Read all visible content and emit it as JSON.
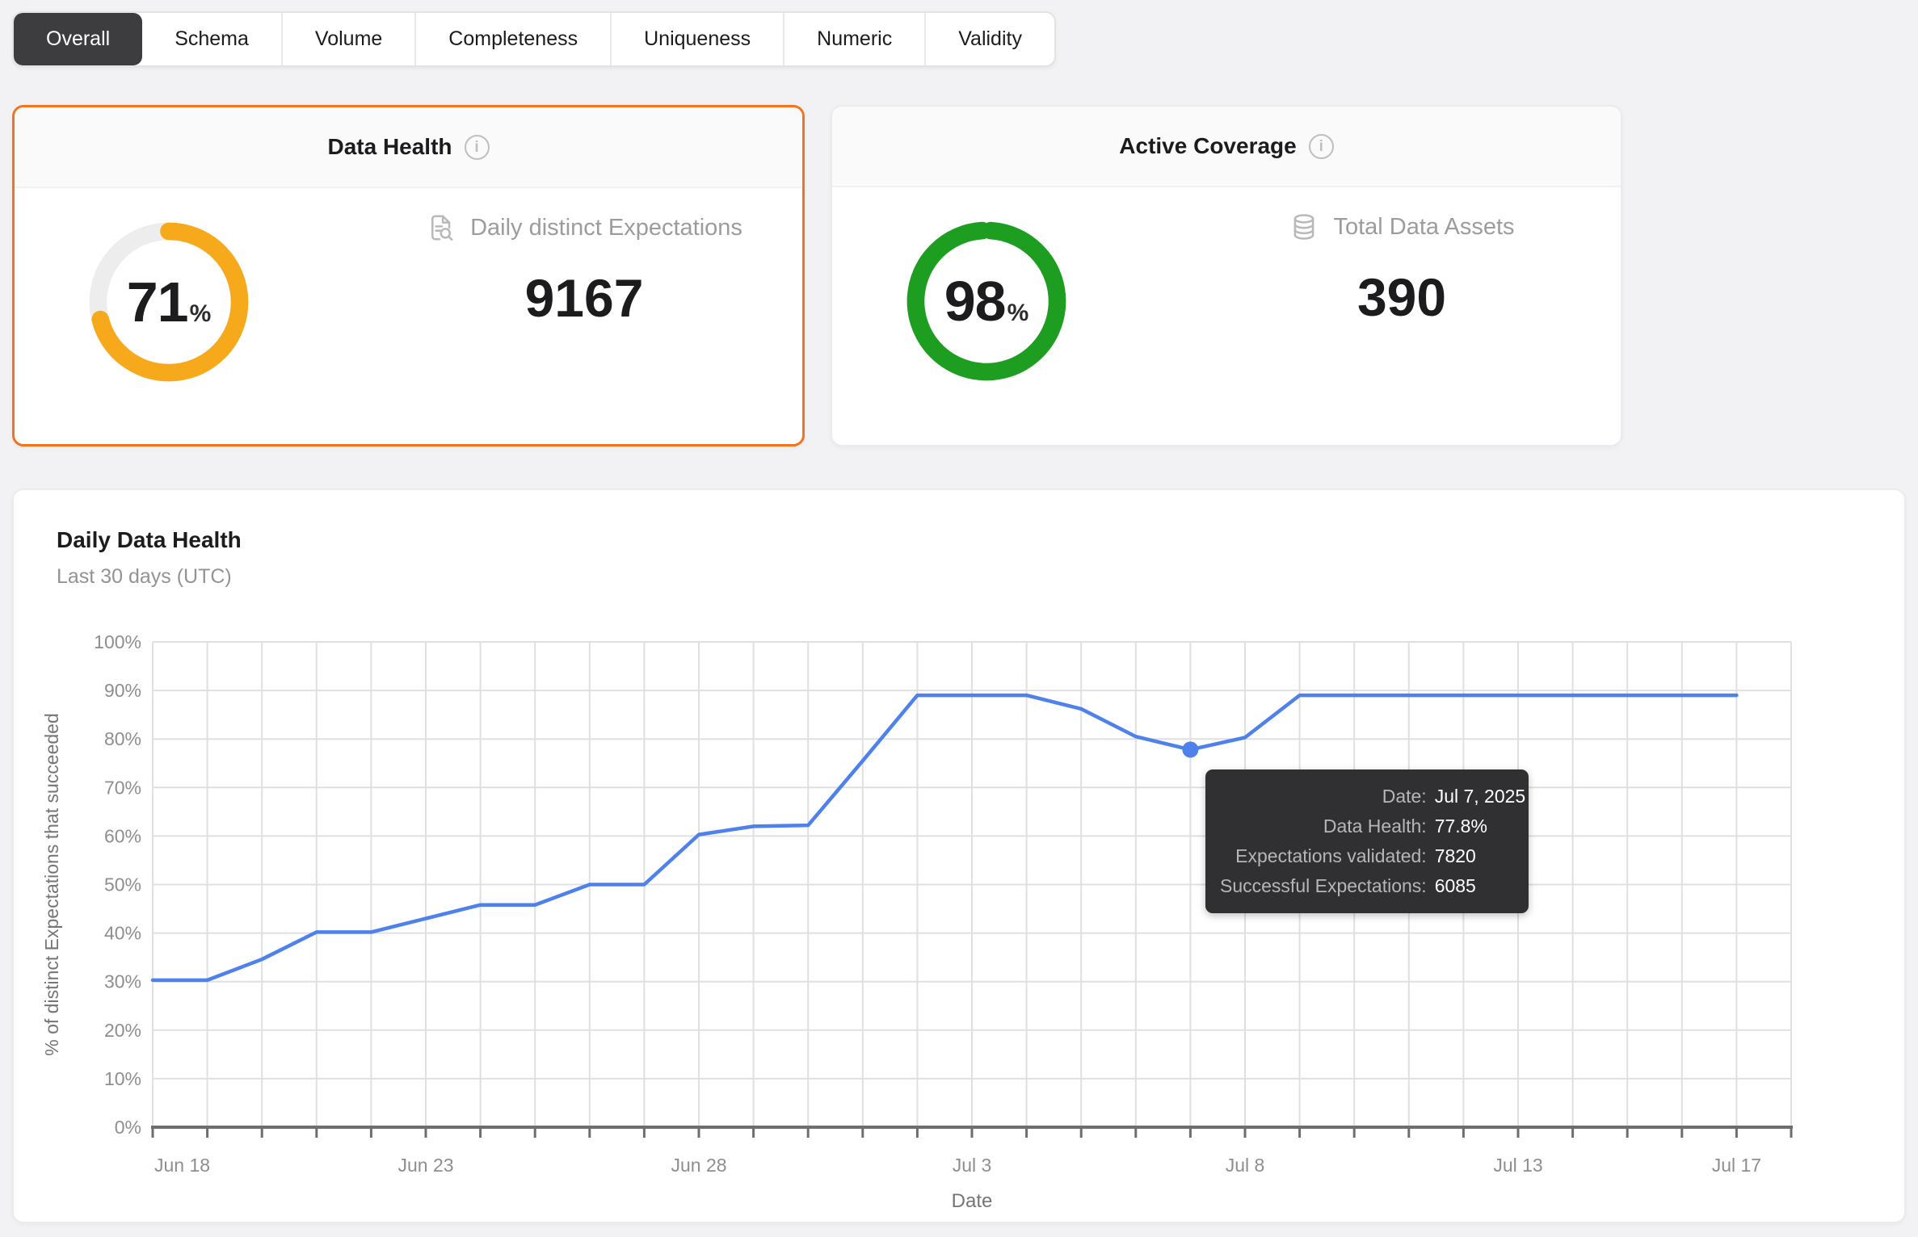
{
  "tabs": {
    "items": [
      {
        "id": "overall",
        "label": "Overall",
        "selected": true
      },
      {
        "id": "schema",
        "label": "Schema",
        "selected": false
      },
      {
        "id": "volume",
        "label": "Volume",
        "selected": false
      },
      {
        "id": "completeness",
        "label": "Completeness",
        "selected": false
      },
      {
        "id": "uniqueness",
        "label": "Uniqueness",
        "selected": false
      },
      {
        "id": "numeric",
        "label": "Numeric",
        "selected": false
      },
      {
        "id": "validity",
        "label": "Validity",
        "selected": false
      }
    ]
  },
  "cards": {
    "data_health": {
      "title": "Data Health",
      "info_icon": "info-circle",
      "percent": 71,
      "percent_value": "71",
      "percent_sign": "%",
      "ring_color": "#F7A91C",
      "ring_track_color": "#EDEDED",
      "border_color": "#F4731C",
      "metric_icon": "document-search",
      "metric_label": "Daily distinct Expectations",
      "metric_value": "9167"
    },
    "active_coverage": {
      "title": "Active Coverage",
      "info_icon": "info-circle",
      "percent": 98,
      "percent_value": "98",
      "percent_sign": "%",
      "ring_color": "#1E9E21",
      "ring_track_color": "#EDEDED",
      "metric_icon": "database",
      "metric_label": "Total Data Assets",
      "metric_value": "390"
    }
  },
  "chart": {
    "title": "Daily Data Health",
    "subtitle": "Last 30 days (UTC)"
  },
  "chart_data": {
    "type": "line",
    "title": "Daily Data Health",
    "subtitle": "Last 30 days (UTC)",
    "xlabel": "Date",
    "ylabel": "% of distinct Expectations that succeeded",
    "x": [
      "Jun 18",
      "Jun 19",
      "Jun 20",
      "Jun 21",
      "Jun 22",
      "Jun 23",
      "Jun 24",
      "Jun 25",
      "Jun 26",
      "Jun 27",
      "Jun 28",
      "Jun 29",
      "Jun 30",
      "Jul 1",
      "Jul 2",
      "Jul 3",
      "Jul 4",
      "Jul 5",
      "Jul 6",
      "Jul 7",
      "Jul 8",
      "Jul 9",
      "Jul 10",
      "Jul 11",
      "Jul 12",
      "Jul 13",
      "Jul 14",
      "Jul 15",
      "Jul 16",
      "Jul 17"
    ],
    "values": [
      30.3,
      30.3,
      34.6,
      40.2,
      40.2,
      43.0,
      45.8,
      45.8,
      50.0,
      50.0,
      60.3,
      62.0,
      62.2,
      75.5,
      89.0,
      89.0,
      89.0,
      86.2,
      80.5,
      77.8,
      80.3,
      89.0,
      89.0,
      89.0,
      89.0,
      89.0,
      89.0,
      89.0,
      89.0,
      89.0
    ],
    "ylim": [
      0,
      100
    ],
    "y_tick_step": 10,
    "y_tick_suffix": "%",
    "x_ticks": [
      {
        "i": 0,
        "label": "Jun 18"
      },
      {
        "i": 5,
        "label": "Jun 23"
      },
      {
        "i": 10,
        "label": "Jun 28"
      },
      {
        "i": 15,
        "label": "Jul 3"
      },
      {
        "i": 20,
        "label": "Jul 8"
      },
      {
        "i": 25,
        "label": "Jul 13"
      },
      {
        "i": 29,
        "label": "Jul 17"
      }
    ],
    "grid": true,
    "legend_position": "none",
    "line_color": "#4E81EC",
    "grid_color": "#E0E0E0",
    "axis_color": "#6E6E6E",
    "tick_label_color": "#8E8E8E",
    "axis_title_color": "#757575",
    "highlight_index": 19
  },
  "tooltip": {
    "rows": [
      {
        "label": "Date:",
        "value": "Jul 7, 2025"
      },
      {
        "label": "Data Health:",
        "value": "77.8%"
      },
      {
        "label": "Expectations validated:",
        "value": "7820"
      },
      {
        "label": "Successful Expectations:",
        "value": "6085"
      }
    ]
  }
}
